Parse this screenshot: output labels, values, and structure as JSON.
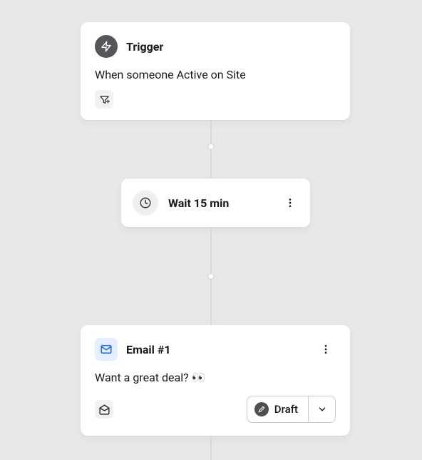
{
  "trigger": {
    "title": "Trigger",
    "description": "When someone Active on Site"
  },
  "wait": {
    "label": "Wait 15 min"
  },
  "email": {
    "title": "Email #1",
    "subject": "Want a great deal? 👀",
    "status": "Draft"
  }
}
